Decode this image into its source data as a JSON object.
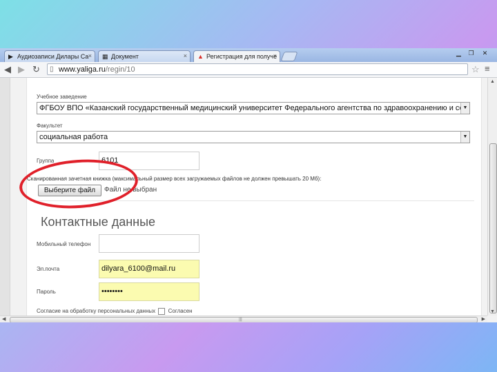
{
  "tabs": [
    {
      "label": "Аудиозаписи Дилары Са",
      "icon": "play-icon"
    },
    {
      "label": "Документ",
      "icon": "document-icon"
    },
    {
      "label": "Регистрация для получе",
      "icon": "yaliga-icon",
      "active": true
    }
  ],
  "window_controls": {
    "minimize": "▁",
    "maximize": "❐",
    "close": "✕"
  },
  "toolbar": {
    "back": "◀",
    "forward": "▶",
    "reload": "↻",
    "url_host": "www.yaliga.ru",
    "url_path": "/regin/10",
    "bookmark": "☆",
    "menu": "🔧"
  },
  "form": {
    "institution_label": "Учебное заведение",
    "institution_value": "ФГБОУ ВПО «Казанский государственный медицинский университет Федерального агентства по здравоохранению и со",
    "faculty_label": "Факультет",
    "faculty_value": "социальная работа",
    "group_label": "Группа",
    "group_value": "6101",
    "scan_hint_prefix": "Сканированная зачетная книжка (максимальный размер всех загружаемых файлов не должен превышать 20 Мб):",
    "file_button": "Выберите файл",
    "file_status": "Файл не выбран",
    "contact_heading": "Контактные данные",
    "phone_label": "Мобильный телефон",
    "phone_value": "",
    "email_label": "Эл.почта",
    "email_value": "dilyara_6100@mail.ru",
    "password_label": "Пароль",
    "password_value": "••••••••",
    "consent_label": "Согласие на обработку персональных данных",
    "consent_check_label": "Согласен"
  },
  "colors": {
    "annotation_circle": "#e0202a",
    "autofill": "#fbfbb0"
  }
}
